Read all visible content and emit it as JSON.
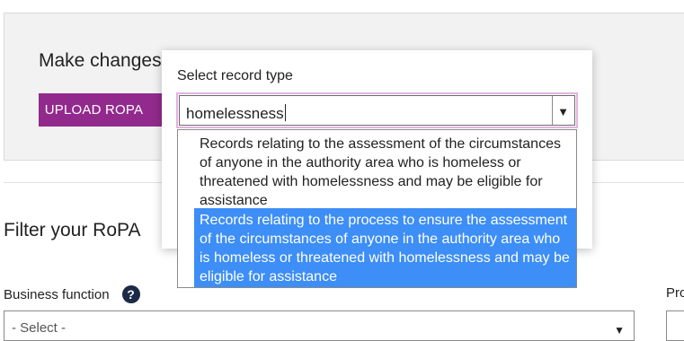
{
  "banner": {
    "title": "Make changes",
    "upload_button": "UPLOAD ROPA"
  },
  "filter": {
    "title": "Filter your RoPA",
    "business_function_label": "Business function",
    "help_icon": "?",
    "business_function_placeholder": "- Select -",
    "process_label_partial": "Pro"
  },
  "modal": {
    "label": "Select record type",
    "search_value": "homelessness",
    "options": [
      {
        "text": "Records relating to the assessment of the circumstances of anyone in the authority area who is homeless or threatened with homelessness and may be eligible for assistance",
        "selected": false
      },
      {
        "text": "Records relating to the process to ensure the assessment of the circumstances of anyone in the authority area who is homeless or threatened with homelessness and may be eligible for assistance",
        "selected": true
      }
    ]
  },
  "colors": {
    "accent": "#922a8e",
    "highlight": "#3d8ef6",
    "focus_ring": "#e3b3e0"
  },
  "icons": {
    "help": "question-circle-icon",
    "dropdown": "caret-down-icon"
  }
}
